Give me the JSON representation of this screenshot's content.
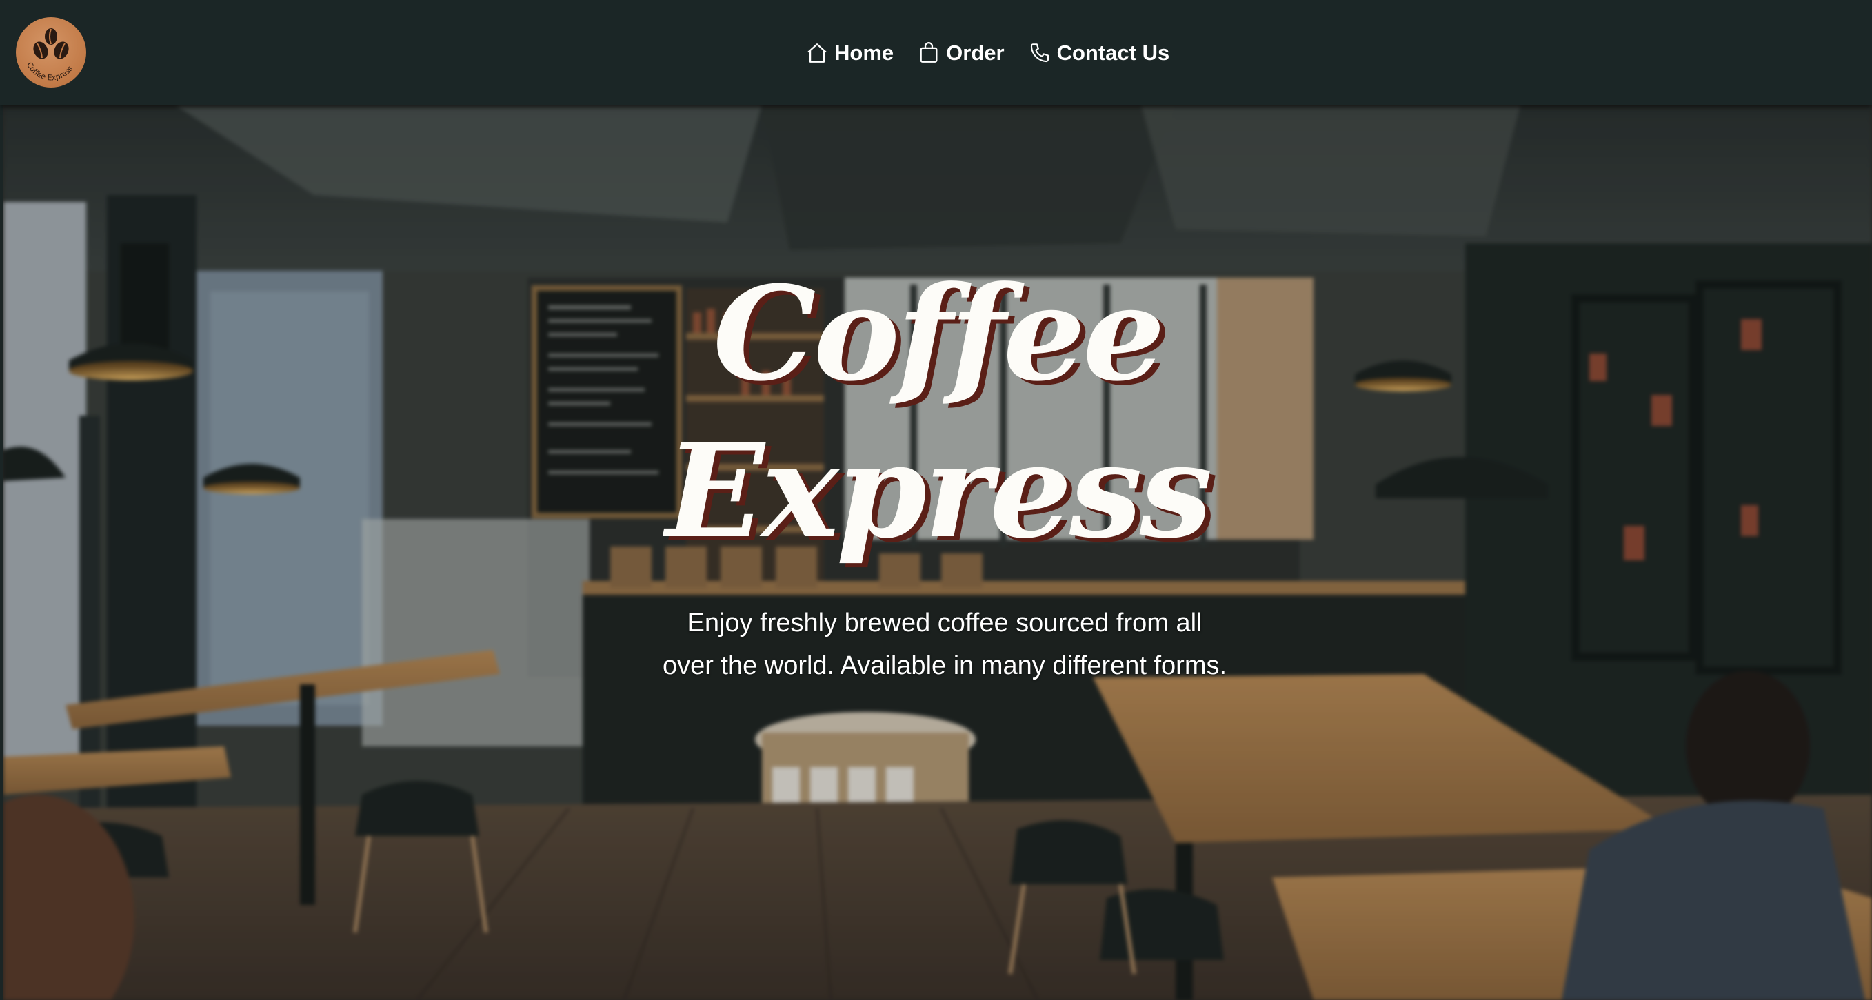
{
  "brand": {
    "logo_text": "Coffee Express",
    "logo_color": "#c27a47"
  },
  "nav": {
    "items": [
      {
        "label": "Home",
        "icon": "home-icon"
      },
      {
        "label": "Order",
        "icon": "shopping-bag-icon"
      },
      {
        "label": "Contact Us",
        "icon": "phone-icon"
      }
    ]
  },
  "hero": {
    "title_line1": "Coffee",
    "title_line2": "Express",
    "subtitle": "Enjoy freshly brewed coffee sourced from all over the world. Available in many different forms.",
    "title_shadow_color": "#5a1f17"
  },
  "colors": {
    "navbar": "#1b2626",
    "text": "#ffffff"
  }
}
